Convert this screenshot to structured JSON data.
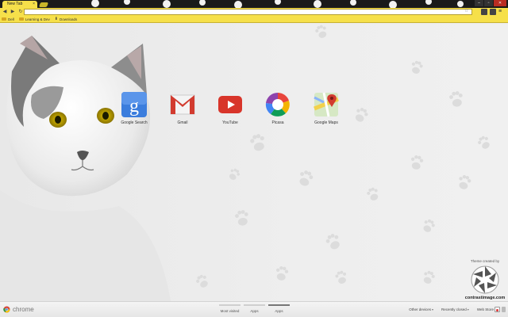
{
  "browser": {
    "tab_title": "New Tab",
    "tab_close": "×",
    "window_controls": [
      "–",
      "▫",
      "✕"
    ],
    "nav": {
      "back": "◀",
      "forward": "▶",
      "reload": "↻"
    },
    "star": "☆",
    "menu": "≡",
    "theme_color": "#f6e04a"
  },
  "bookmarks": [
    {
      "label": "Dell",
      "icon": "folder-icon"
    },
    {
      "label": "Learning & Dev",
      "icon": "folder-icon"
    },
    {
      "label": "Downloads",
      "icon": "download-icon"
    }
  ],
  "apps": [
    {
      "name": "google-search",
      "label": "Google Search",
      "icon": "google-search-icon"
    },
    {
      "name": "gmail",
      "label": "Gmail",
      "icon": "gmail-icon"
    },
    {
      "name": "youtube",
      "label": "YouTube",
      "icon": "youtube-icon"
    },
    {
      "name": "picasa",
      "label": "Picasa",
      "icon": "picasa-icon"
    },
    {
      "name": "google-maps",
      "label": "Google Maps",
      "icon": "google-maps-icon"
    }
  ],
  "theme_credit": {
    "label": "Theme created by",
    "site": "contrastimage.com"
  },
  "footer": {
    "brand": "chrome",
    "pages": [
      {
        "label": "Most visited",
        "active": false
      },
      {
        "label": "Apps",
        "active": false
      },
      {
        "label": "Apps",
        "active": true
      }
    ],
    "other_devices": "Other devices",
    "recently_closed": "Recently closed",
    "web_store": "Web Store"
  }
}
